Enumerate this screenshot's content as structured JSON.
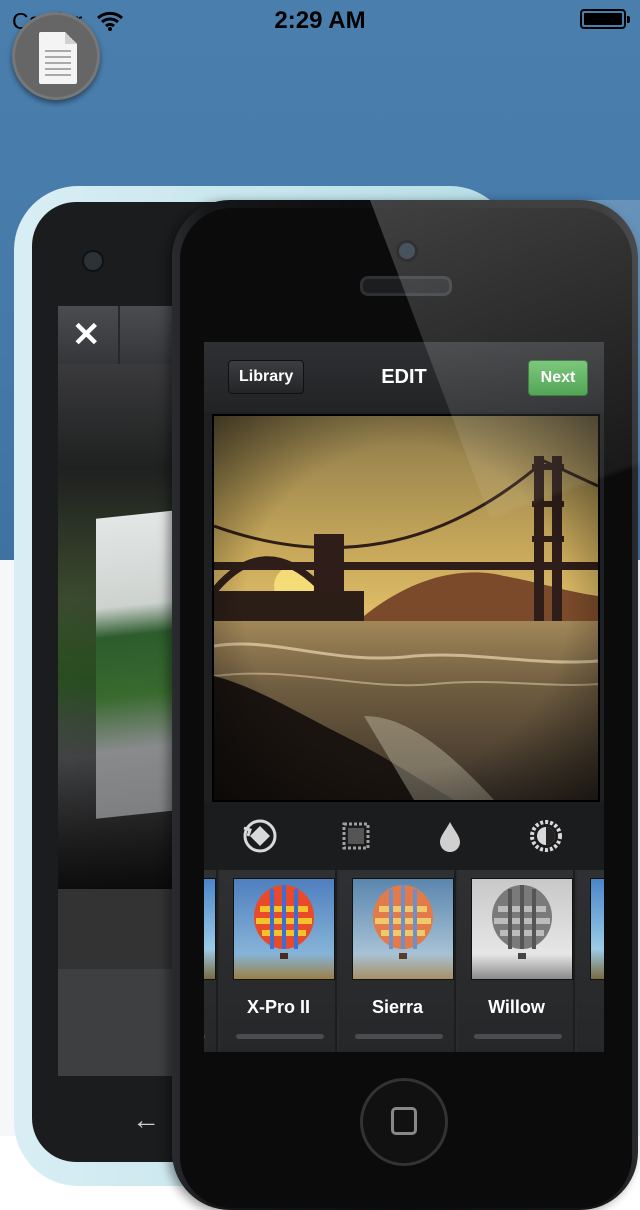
{
  "status_bar": {
    "carrier": "Carrier",
    "time": "2:29 AM"
  },
  "doc_button": {
    "icon": "document-icon"
  },
  "back_phone": {
    "close_icon": "✕",
    "arrow_icon": "←"
  },
  "edit_screen": {
    "nav": {
      "library_label": "Library",
      "title": "EDIT",
      "next_label": "Next"
    },
    "tools": [
      "rotate-icon",
      "border-frame-icon",
      "lux-drop-icon",
      "brightness-icon"
    ],
    "filters": [
      {
        "label": "X-Pro II"
      },
      {
        "label": "Sierra"
      },
      {
        "label": "Willow"
      }
    ]
  },
  "colors": {
    "background_blue": "#4679a8",
    "next_green": "#4caf50",
    "screen_dark": "#1e1f21"
  }
}
